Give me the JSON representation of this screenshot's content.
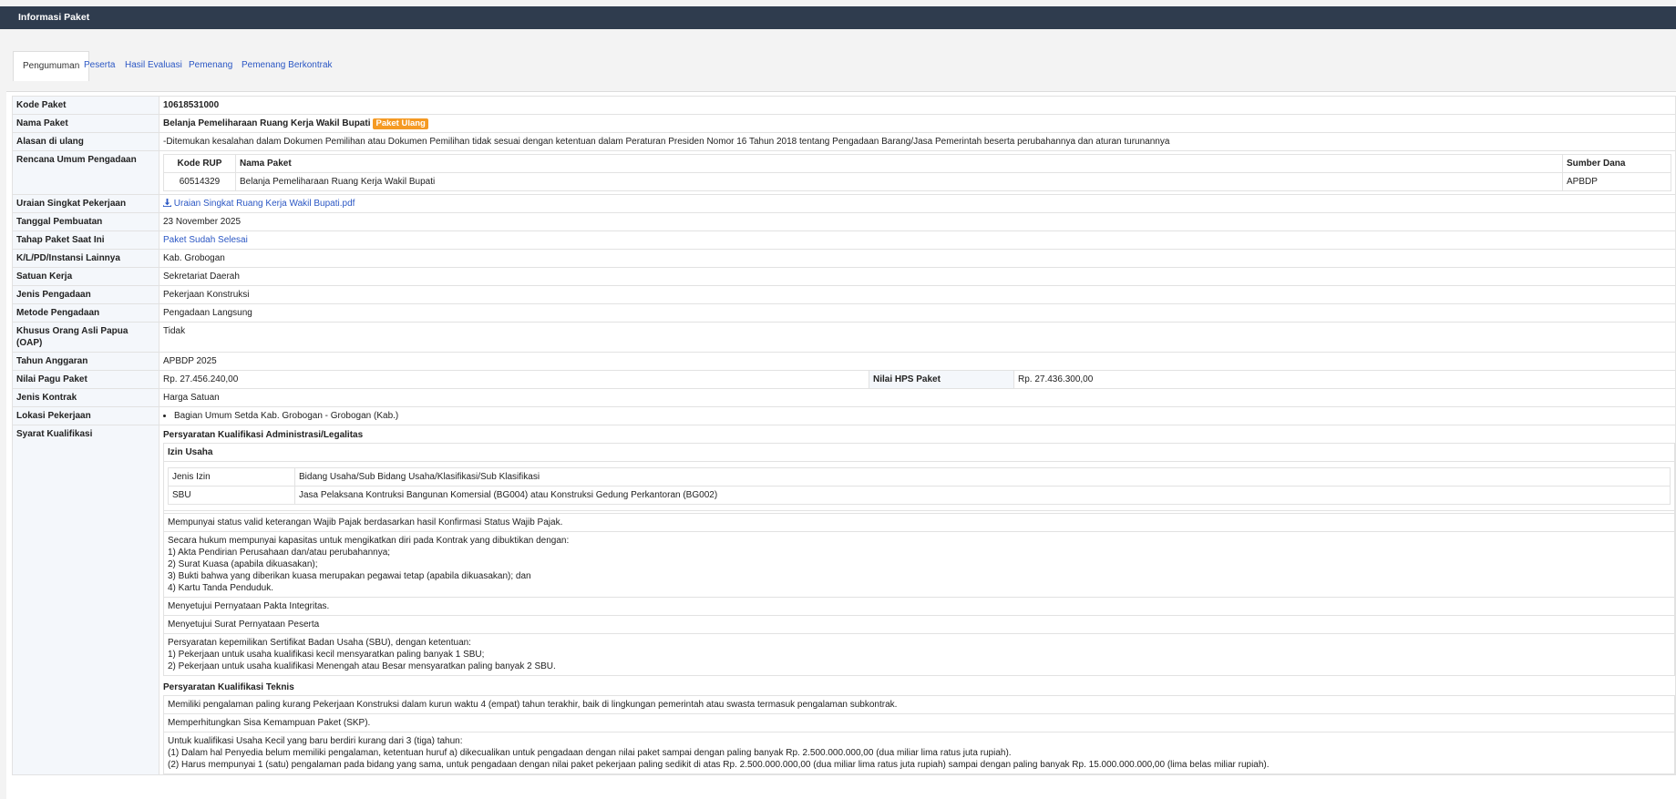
{
  "header": {
    "title": "Informasi Paket"
  },
  "tabs": [
    {
      "label": "Pengumuman"
    },
    {
      "label": "Peserta"
    },
    {
      "label": "Hasil Evaluasi"
    },
    {
      "label": "Pemenang"
    },
    {
      "label": "Pemenang Berkontrak"
    }
  ],
  "fields": {
    "kode_paket": {
      "label": "Kode Paket",
      "value": "10618531000"
    },
    "nama_paket": {
      "label": "Nama Paket",
      "value": "Belanja Pemeliharaan Ruang Kerja Wakil Bupati",
      "badge": "Paket Ulang"
    },
    "alasan": {
      "label": "Alasan di ulang",
      "value": "-Ditemukan kesalahan dalam Dokumen Pemilihan atau Dokumen Pemilihan tidak sesuai dengan ketentuan dalam Peraturan Presiden Nomor 16 Tahun 2018 tentang Pengadaan Barang/Jasa Pemerintah beserta perubahannya dan aturan turunannya"
    },
    "rup": {
      "label": "Rencana Umum Pengadaan",
      "headers": [
        "Kode RUP",
        "Nama Paket",
        "Sumber Dana"
      ],
      "row": [
        "60514329",
        "Belanja Pemeliharaan Ruang Kerja Wakil Bupati",
        "APBDP"
      ]
    },
    "uraian": {
      "label": "Uraian Singkat Pekerjaan",
      "value": "Uraian Singkat Ruang Kerja Wakil Bupati.pdf"
    },
    "tanggal": {
      "label": "Tanggal Pembuatan",
      "value": "23 November 2025"
    },
    "tahap": {
      "label": "Tahap Paket Saat Ini",
      "value": "Paket Sudah Selesai"
    },
    "klpd": {
      "label": "K/L/PD/Instansi Lainnya",
      "value": "Kab. Grobogan"
    },
    "satker": {
      "label": "Satuan Kerja",
      "value": "Sekretariat Daerah"
    },
    "jenis_pengadaan": {
      "label": "Jenis Pengadaan",
      "value": "Pekerjaan Konstruksi"
    },
    "metode": {
      "label": "Metode Pengadaan",
      "value": "Pengadaan Langsung"
    },
    "oap": {
      "label": "Khusus Orang Asli Papua (OAP)",
      "value": "Tidak"
    },
    "tahun": {
      "label": "Tahun Anggaran",
      "value": "APBDP 2025"
    },
    "pagu": {
      "label": "Nilai Pagu Paket",
      "value": "Rp. 27.456.240,00",
      "hps_label": "Nilai HPS Paket",
      "hps_value": "Rp. 27.436.300,00"
    },
    "kontrak": {
      "label": "Jenis Kontrak",
      "value": "Harga Satuan"
    },
    "lokasi": {
      "label": "Lokasi Pekerjaan",
      "value": "Bagian Umum Setda Kab. Grobogan - Grobogan (Kab.)"
    },
    "syarat": {
      "label": "Syarat Kualifikasi",
      "admin_title": "Persyaratan Kualifikasi Administrasi/Legalitas",
      "izin_title": "Izin Usaha",
      "izin_headers": [
        "Jenis Izin",
        "Bidang Usaha/Sub Bidang Usaha/Klasifikasi/Sub Klasifikasi"
      ],
      "izin_row": [
        "SBU",
        "Jasa Pelaksana Kontruksi Bangunan Komersial (BG004) atau Konstruksi Gedung Perkantoran (BG002)"
      ],
      "pajak": "Mempunyai status valid keterangan Wajib Pajak berdasarkan hasil Konfirmasi Status Wajib Pajak.",
      "hukum": [
        "Secara hukum mempunyai kapasitas untuk mengikatkan diri pada Kontrak yang dibuktikan dengan:",
        "1) Akta Pendirian Perusahaan dan/atau perubahannya;",
        "2) Surat Kuasa (apabila dikuasakan);",
        "3) Bukti bahwa yang diberikan kuasa merupakan pegawai tetap (apabila dikuasakan); dan",
        "4) Kartu Tanda Penduduk."
      ],
      "pakta": "Menyetujui Pernyataan Pakta Integritas.",
      "surat": "Menyetujui Surat Pernyataan Peserta",
      "sbu": [
        "Persyaratan kepemilikan Sertifikat Badan Usaha (SBU), dengan ketentuan:",
        "1) Pekerjaan untuk usaha kualifikasi kecil mensyaratkan paling banyak 1 SBU;",
        "2) Pekerjaan untuk usaha kualifikasi Menengah atau Besar mensyaratkan paling banyak 2 SBU."
      ],
      "teknis_title": "Persyaratan Kualifikasi Teknis",
      "pengalaman": "Memiliki pengalaman paling kurang Pekerjaan Konstruksi dalam kurun waktu 4 (empat) tahun terakhir, baik di lingkungan pemerintah atau swasta termasuk pengalaman subkontrak.",
      "skp": "Memperhitungkan Sisa Kemampuan Paket (SKP).",
      "kecil": [
        "Untuk kualifikasi Usaha Kecil yang baru berdiri kurang dari 3 (tiga) tahun:",
        "(1) Dalam hal Penyedia belum memiliki pengalaman, ketentuan huruf a) dikecualikan untuk pengadaan dengan nilai paket sampai dengan paling banyak Rp. 2.500.000.000,00 (dua miliar lima ratus juta rupiah).",
        "(2) Harus mempunyai 1 (satu) pengalaman pada bidang yang sama, untuk pengadaan dengan nilai paket pekerjaan paling sedikit di atas Rp. 2.500.000.000,00 (dua miliar lima ratus juta rupiah) sampai dengan paling banyak Rp. 15.000.000.000,00 (lima belas miliar rupiah)."
      ]
    }
  },
  "icons": {
    "download": "download-icon"
  },
  "colors": {
    "header_bg": "#2f3c4e",
    "badge": "#f59a23",
    "link": "#2b57c4"
  }
}
